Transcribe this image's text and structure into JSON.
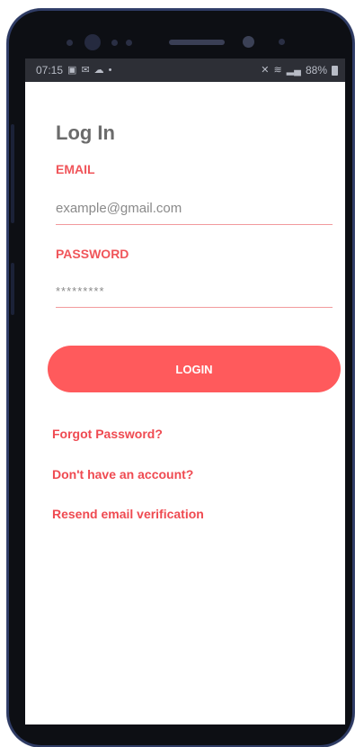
{
  "statusbar": {
    "time": "07:15",
    "battery": "88%"
  },
  "login": {
    "title": "Log In",
    "email_label": "EMAIL",
    "email_placeholder": "example@gmail.com",
    "email_value": "",
    "password_label": "PASSWORD",
    "password_value": "*********",
    "login_button": "LOGIN",
    "forgot_link": "Forgot Password?",
    "signup_link": "Don't have an account?",
    "resend_link": "Resend email verification"
  },
  "colors": {
    "accent": "#ff5a5c",
    "label": "#f0555a",
    "title": "#6b6b6b",
    "statusbar": "#2d2f36"
  },
  "icons": [
    "gallery-icon",
    "mail-icon",
    "cloud-icon",
    "mute-icon",
    "wifi-icon",
    "signal-icon",
    "battery-icon"
  ]
}
